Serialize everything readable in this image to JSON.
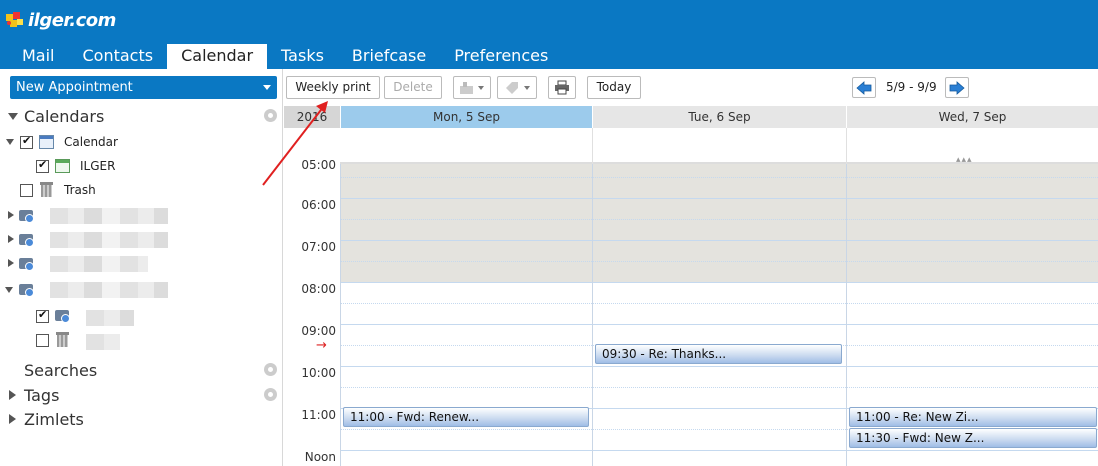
{
  "header": {
    "logo_text": "ilger.com",
    "tabs": [
      {
        "label": "Mail"
      },
      {
        "label": "Contacts"
      },
      {
        "label": "Calendar",
        "active": true
      },
      {
        "label": "Tasks"
      },
      {
        "label": "Briefcase"
      },
      {
        "label": "Preferences"
      }
    ],
    "bg_color": "#0a78c3"
  },
  "sidebar": {
    "new_button_label": "New Appointment",
    "calendars_title": "Calendars",
    "calendar_items": [
      {
        "label": "Calendar",
        "checked": true
      },
      {
        "label": "ILGER",
        "checked": true
      },
      {
        "label": "Trash",
        "checked": false
      }
    ],
    "searches_label": "Searches",
    "tags_label": "Tags",
    "zimlets_label": "Zimlets"
  },
  "toolbar": {
    "weekly_print_label": "Weekly print",
    "delete_label": "Delete",
    "today_label": "Today",
    "range_label": "5/9 - 9/9"
  },
  "calendar": {
    "year": "2016",
    "days": [
      {
        "label": "Mon, 5 Sep",
        "today": true
      },
      {
        "label": "Tue, 6 Sep",
        "today": false
      },
      {
        "label": "Wed, 7 Sep",
        "today": false
      }
    ],
    "hours": [
      "05:00",
      "06:00",
      "07:00",
      "08:00",
      "09:00",
      "10:00",
      "11:00",
      "Noon"
    ],
    "appointments": [
      {
        "day": 0,
        "text": "11:00 - Fwd: Renew..."
      },
      {
        "day": 1,
        "text": "09:30 - Re: Thanks..."
      },
      {
        "day": 2,
        "text": "11:00 - Re: New Zi..."
      },
      {
        "day": 2,
        "text": "11:30 - Fwd: New Z..."
      }
    ],
    "now_marker": "→",
    "more_marker": "▴▴▴"
  }
}
